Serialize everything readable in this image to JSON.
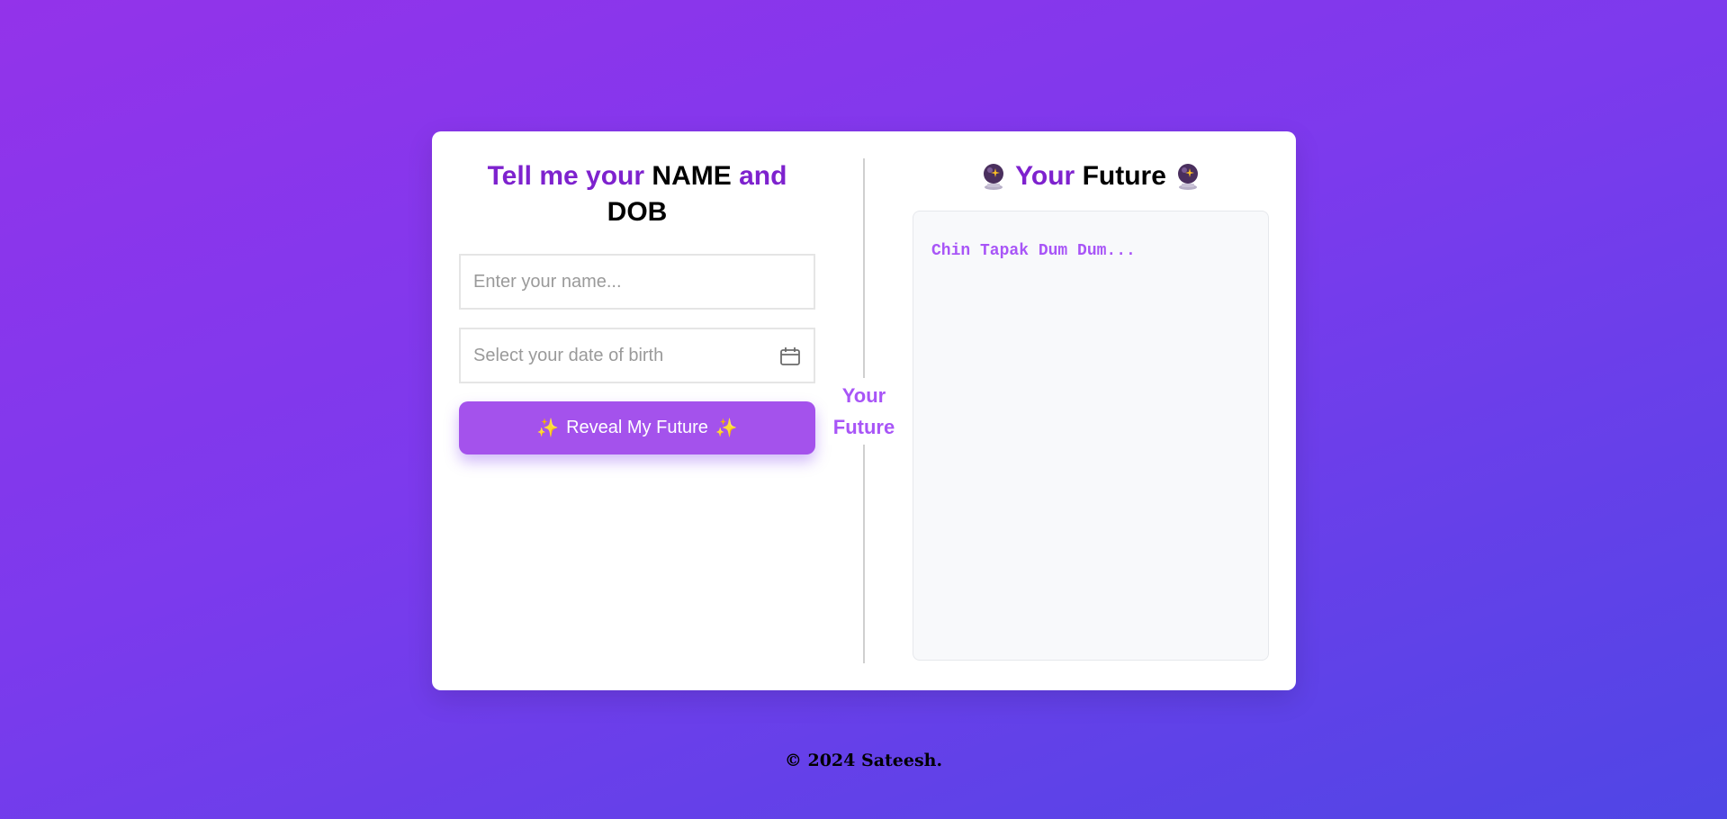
{
  "left": {
    "title_part1": "Tell me your",
    "title_name": "NAME",
    "title_and": "and",
    "title_dob": "DOB",
    "name_placeholder": "Enter your name...",
    "dob_placeholder": "Select your date of birth",
    "dob_icon": "calendar-icon",
    "button_label": "Reveal My Future",
    "button_sparkle": "✨"
  },
  "divider": {
    "label_line1": "Your",
    "label_line2": "Future"
  },
  "right": {
    "title_your": "Your",
    "title_future": "Future",
    "title_icon": "crystal-ball-icon",
    "result_text": "Chin Tapak Dum Dum..."
  },
  "footer": {
    "text": "© 2024 Sateesh."
  },
  "colors": {
    "accent": "#7e22ce",
    "button": "#a452ec",
    "result_text": "#a855f7",
    "sparkle": "#fbbf24",
    "background_start": "#9333ea",
    "background_end": "#4f46e5"
  }
}
